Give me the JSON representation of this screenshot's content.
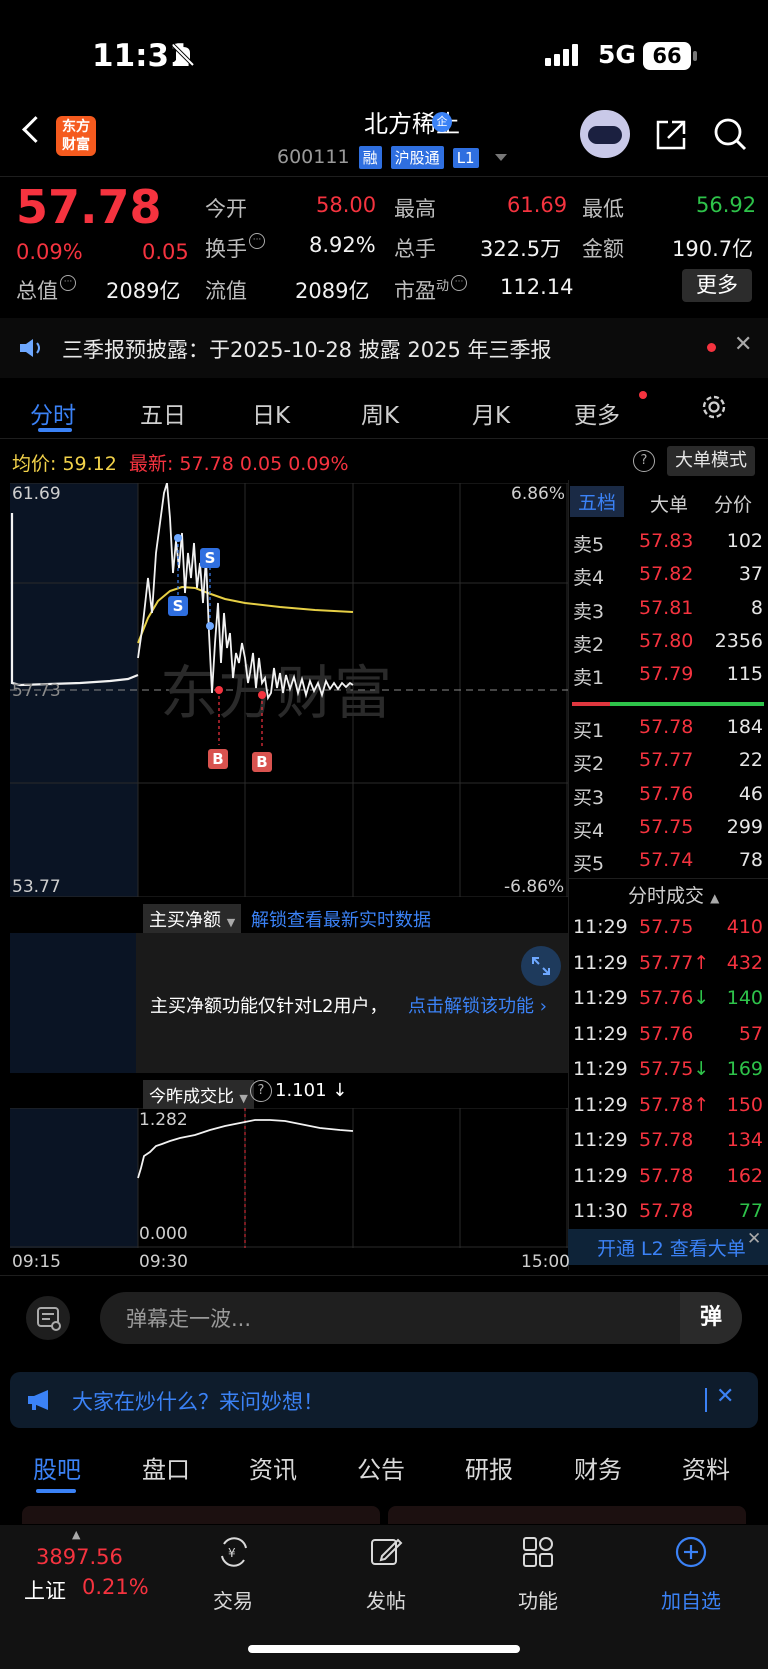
{
  "status_bar": {
    "time": "11:31",
    "network": "5G",
    "battery": "66"
  },
  "header": {
    "logo_line1": "东方",
    "logo_line2": "财富",
    "stock_name": "北方稀土",
    "badge": "企",
    "code": "600111",
    "tags": [
      "融",
      "沪股通",
      "L1"
    ]
  },
  "quote": {
    "price": "57.78",
    "change_pct": "0.09%",
    "change": "0.05",
    "open_label": "今开",
    "open": "58.00",
    "high_label": "最高",
    "high": "61.69",
    "low_label": "最低",
    "low": "56.92",
    "turnover_label": "换手",
    "turnover": "8.92%",
    "volume_label": "总手",
    "volume": "322.5万",
    "amount_label": "金额",
    "amount": "190.7亿",
    "mktcap_label": "总值",
    "mktcap": "2089亿",
    "float_label": "流值",
    "float": "2089亿",
    "pe_label": "市盈",
    "pe_sup": "动",
    "pe": "112.14",
    "more": "更多"
  },
  "notice": {
    "text": "三季报预披露：于2025-10-28 披露 2025 年三季报"
  },
  "chart_tabs": [
    "分时",
    "五日",
    "日K",
    "周K",
    "月K",
    "更多"
  ],
  "info_line": {
    "avg_label": "均价:",
    "avg": "59.12",
    "latest_label": "最新:",
    "latest": "57.78",
    "chg": "0.05",
    "pct": "0.09%",
    "big_mode": "大单模式"
  },
  "chart_labels": {
    "y_top": "61.69",
    "y_mid": "57.73",
    "y_bottom": "53.77",
    "pct_top": "6.86%",
    "pct_bottom": "-6.86%",
    "marker_s": "S",
    "marker_b": "B",
    "x_start": "09:15",
    "x_open": "09:30",
    "x_end": "15:00",
    "net_buy_tag": "主买净额",
    "unlock_text": "解锁查看最新实时数据",
    "l2_msg": "主买净额功能仅针对L2用户，",
    "l2_link": "点击解锁该功能",
    "ratio_tag": "今昨成交比",
    "ratio_value": "1.101",
    "ratio_top": "1.282",
    "ratio_bottom": "0.000"
  },
  "chart_data": {
    "type": "line",
    "x_unit": "time",
    "series": [],
    "ylim": [
      53.77,
      61.69
    ],
    "reference": 57.73
  },
  "order_book": {
    "tabs": [
      "五档",
      "大单",
      "分价"
    ],
    "asks": [
      {
        "label": "卖5",
        "price": "57.83",
        "vol": "102"
      },
      {
        "label": "卖4",
        "price": "57.82",
        "vol": "37"
      },
      {
        "label": "卖3",
        "price": "57.81",
        "vol": "8"
      },
      {
        "label": "卖2",
        "price": "57.80",
        "vol": "2356"
      },
      {
        "label": "卖1",
        "price": "57.79",
        "vol": "115"
      }
    ],
    "bids": [
      {
        "label": "买1",
        "price": "57.78",
        "vol": "184"
      },
      {
        "label": "买2",
        "price": "57.77",
        "vol": "22"
      },
      {
        "label": "买3",
        "price": "57.76",
        "vol": "46"
      },
      {
        "label": "买4",
        "price": "57.75",
        "vol": "299"
      },
      {
        "label": "买5",
        "price": "57.74",
        "vol": "78"
      }
    ]
  },
  "trades": {
    "title": "分时成交",
    "rows": [
      {
        "t": "11:29",
        "p": "57.75",
        "dir": "",
        "v": "410",
        "vc": "red"
      },
      {
        "t": "11:29",
        "p": "57.77",
        "dir": "↑",
        "v": "432",
        "vc": "red"
      },
      {
        "t": "11:29",
        "p": "57.76",
        "dir": "↓",
        "v": "140",
        "vc": "green"
      },
      {
        "t": "11:29",
        "p": "57.76",
        "dir": "",
        "v": "57",
        "vc": "red"
      },
      {
        "t": "11:29",
        "p": "57.75",
        "dir": "↓",
        "v": "169",
        "vc": "green"
      },
      {
        "t": "11:29",
        "p": "57.78",
        "dir": "↑",
        "v": "150",
        "vc": "red"
      },
      {
        "t": "11:29",
        "p": "57.78",
        "dir": "",
        "v": "134",
        "vc": "red"
      },
      {
        "t": "11:29",
        "p": "57.78",
        "dir": "",
        "v": "162",
        "vc": "red"
      },
      {
        "t": "11:30",
        "p": "57.78",
        "dir": "",
        "v": "77",
        "vc": "green"
      }
    ],
    "l2_promo": "开通 L2 查看大单"
  },
  "danmu": {
    "placeholder": "弹幕走一波...",
    "button": "弹"
  },
  "ask": {
    "text": "大家在炒什么？来问妙想！"
  },
  "sub_tabs": [
    "股吧",
    "盘口",
    "资讯",
    "公告",
    "研报",
    "财务",
    "资料"
  ],
  "bottom_nav": {
    "index_value": "3897.56",
    "index_name": "上证",
    "index_pct": "0.21%",
    "items": [
      "交易",
      "发帖",
      "功能",
      "加自选"
    ]
  }
}
